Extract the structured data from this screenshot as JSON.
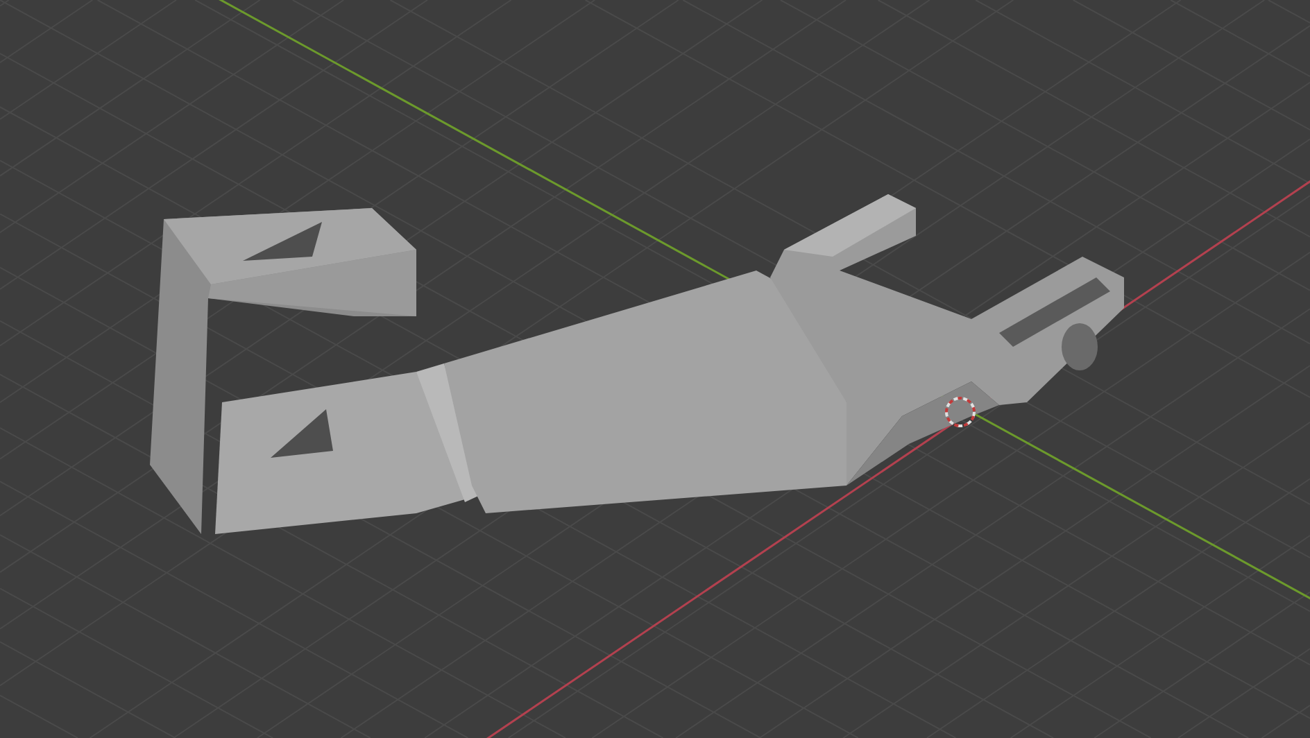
{
  "viewport": {
    "axes": [
      {
        "kind": "x",
        "color": "#b3414f"
      },
      {
        "kind": "y",
        "color": "#6c9a2c"
      }
    ]
  }
}
